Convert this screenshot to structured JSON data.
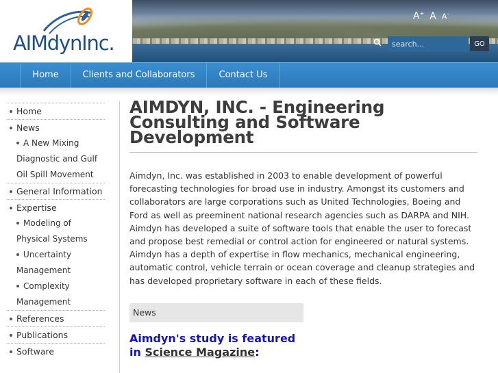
{
  "brand": {
    "logo_text": "AIMdynInc.",
    "colors": {
      "logo_blue": "#1f4e86",
      "swoosh_orange": "#f08c1e",
      "nav_blue": "#2a79bb",
      "feature_blue": "#1414b8"
    }
  },
  "header": {
    "font_sizer": {
      "increase": "A",
      "reset": "A",
      "decrease": "A"
    },
    "search": {
      "placeholder": "search...",
      "button": "GO",
      "icon": "search-icon"
    }
  },
  "nav": {
    "items": [
      {
        "label": "Home"
      },
      {
        "label": "Clients and Collaborators"
      },
      {
        "label": "Contact Us"
      }
    ]
  },
  "sidebar": {
    "items": [
      {
        "label": "Home",
        "level": 1
      },
      {
        "label": "News",
        "level": 1
      },
      {
        "label": "A New Mixing Diagnostic and Gulf Oil Spill Movement",
        "level": 2
      },
      {
        "label": "General Information",
        "level": 1
      },
      {
        "label": "Expertise",
        "level": 1
      },
      {
        "label": "Modeling of Physical Systems",
        "level": 2
      },
      {
        "label": "Uncertainty Management",
        "level": 2
      },
      {
        "label": "Complexity Management",
        "level": 2
      },
      {
        "label": "References",
        "level": 1
      },
      {
        "label": "Publications",
        "level": 1
      },
      {
        "label": "Software",
        "level": 1
      }
    ]
  },
  "main": {
    "title": "AIMDYN, INC. - Engineering Consulting and Software Development",
    "intro": "Aimdyn, Inc. was established in 2003 to enable development of powerful forecasting technologies for broad use in industry. Amongst its customers and collaborators are large corporations such as United Technologies, Boeing and Ford as well as preeminent national research agencies such as DARPA and NIH. Aimdyn has developed a suite of software tools that enable the user to forecast and propose best remedial or control action for engineered or natural systems. Aimdyn has a depth of expertise in flow mechanics, mechanical engineering, automatic control, vehicle terrain or ocean coverage and cleanup strategies and has developed proprietary software in each of these fields.",
    "news_heading": "News",
    "feature": {
      "line1": "Aimdyn's study is featured",
      "line2_prefix": "in ",
      "link": "Science Magazine",
      "suffix": ":"
    }
  }
}
